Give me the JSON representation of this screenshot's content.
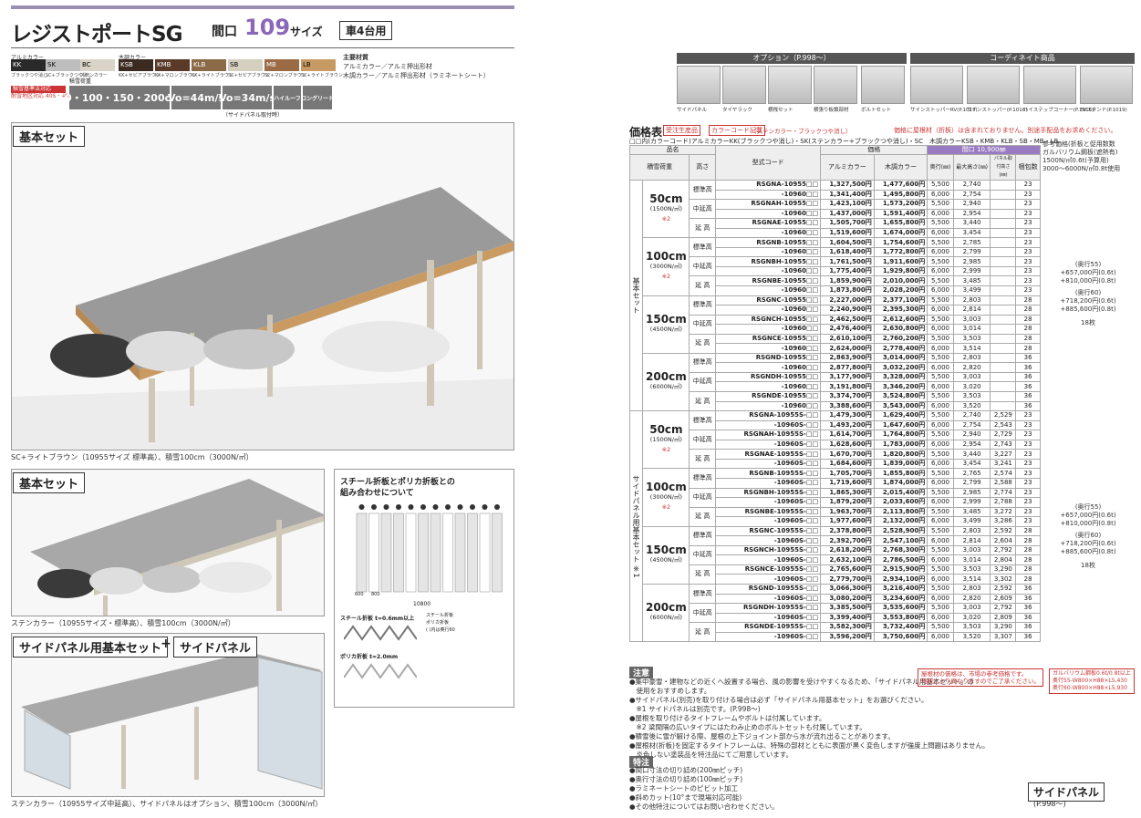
{
  "header": {
    "title": "レジストポートSG",
    "maguchi": "間口",
    "size": "109",
    "size_label": "サイズ",
    "cars": "車4台用"
  },
  "colors": {
    "alumi_label": "アルミカラー",
    "mokume_label": "木調カラー",
    "alumi": [
      {
        "code": "KK",
        "name": "ブラックつや消し",
        "hex": "#2a2a2a",
        "fg": "#fff"
      },
      {
        "code": "SK",
        "name": "SC+ブラックつや消し",
        "hex": "#bdbdbd",
        "fg": "#000"
      },
      {
        "code": "BC",
        "name": "ステンカラー",
        "hex": "#d9d4c7",
        "fg": "#000"
      }
    ],
    "mokume": [
      {
        "code": "KSB",
        "name": "KK+セピアブラウン",
        "hex": "#3b2a1f",
        "fg": "#fff"
      },
      {
        "code": "KMB",
        "name": "KK+マロンブラウン",
        "hex": "#5a3a28",
        "fg": "#fff"
      },
      {
        "code": "KLB",
        "name": "KK+ライトブラウン",
        "hex": "#8b6a47",
        "fg": "#fff"
      },
      {
        "code": "SB",
        "name": "SC+セピアブラウン",
        "hex": "#d5cfc0",
        "fg": "#000"
      },
      {
        "code": "MB",
        "name": "SC+マロンブラウン",
        "hex": "#9a6b45",
        "fg": "#fff"
      },
      {
        "code": "LB",
        "name": "SC+ライトブラウン",
        "hex": "#c79a63",
        "fg": "#000"
      }
    ]
  },
  "materials": [
    "主要材質",
    "アルミカラー／アルミ押出形材",
    "木調カラー／アルミ押出形材（ラミネートシート）"
  ],
  "specs": {
    "shintai": "積雪荷重",
    "snow": "50・100・150・200cm",
    "wind1": "Vo=44m/s",
    "wind2": "Vo=34m/s",
    "wind_note": "（サイドパネル取付時）",
    "extra": [
      "ハイルーフ",
      "ロングリード"
    ],
    "red_title": "積雪基準法対応",
    "red_sub": "耐雪地区対応 40S・40S・41X(750)"
  },
  "photos": [
    {
      "label": "基本セット",
      "caption": "SC+ライトブラウン（10955サイズ 標準高）、積雪100cm（3000N/㎡）"
    },
    {
      "label": "基本セット",
      "caption": "ステンカラー（10955サイズ・標準高）、積雪100cm（3000N/㎡）"
    },
    {
      "label": "サイドパネル用基本セット",
      "plus": "+",
      "label2": "サイドパネル",
      "caption": "ステンカラー（10955サイズ中延高）、サイドパネルはオプション、積雪100cm（3000N/㎡）"
    }
  ],
  "steel": {
    "title1": "スチール折板とポリカ折板との",
    "title2": "組み合わせについて",
    "dim1": "10800",
    "dim2": "600",
    "dim3": "800",
    "steel_label": "スチール折板 t=0.6mm以上",
    "poly_label": "ポリカ折板 t=2.0mm",
    "legend": [
      "スチール折板",
      "ポリカ折板",
      "( )内は奥行60"
    ]
  },
  "options": {
    "header": "オプション（P.998〜）",
    "coord": "コーディネイト商品",
    "items": [
      "サイドパネル",
      "タイヤラック",
      "横桟セット",
      "横張り板鎖部材",
      "ボルトセット",
      "サインストッパーRV(P.1017)",
      "サインストッパー(P.1016)",
      "ハイステップコーナー(P.1016)",
      "EVスタンド(P.1019)"
    ]
  },
  "price": {
    "title": "価格表",
    "tag1": "受注生産品",
    "tag2": "カラーコード記載",
    "tag2_note": "（ステンカラー・ブラックつや消し）",
    "red_note": "価格に屋根材（折板）は含まれておりません。別途手配品をお求めください。",
    "note1": "□□内(カラーコード)アルミカラーKK(ブラックつや消し)・SK(ステンカラー+ブラックつや消し)・SC　木調カラーKSB・KMB・KLB・SB・MB・LB",
    "maguchi": "間口 10,900㎜",
    "headers": {
      "hinmei": "品名",
      "sekisetsu": "積雪荷重",
      "takasa": "高さ",
      "code": "型式コード",
      "price": "価格",
      "alumi": "アルミカラー",
      "mokume": "木調カラー",
      "okuyuki": "奥行(㎜)",
      "saidai": "最大高さ(㎜)",
      "panel": "パネル取付高さ(㎜)",
      "orita": "梱包数"
    },
    "groups": [
      "基本セット",
      "サイドパネル用基本セット ※1"
    ],
    "rows": [
      [
        "50cm",
        "(1500N/㎡)",
        "※2",
        "標準高",
        "RSGNA-10955□□",
        "1,327,500円",
        "1,477,600円",
        "5,500",
        "2,740",
        "",
        "23"
      ],
      [
        "",
        "",
        "",
        "",
        "-10960□□",
        "1,341,400円",
        "1,495,800円",
        "6,000",
        "2,754",
        "",
        "23"
      ],
      [
        "",
        "",
        "",
        "中延高",
        "RSGNAH-10955□□",
        "1,423,100円",
        "1,573,200円",
        "5,500",
        "2,940",
        "",
        "23"
      ],
      [
        "",
        "",
        "",
        "",
        "-10960□□",
        "1,437,000円",
        "1,591,400円",
        "6,000",
        "2,954",
        "",
        "23"
      ],
      [
        "",
        "",
        "",
        "延 高",
        "RSGNAE-10955□□",
        "1,505,700円",
        "1,655,800円",
        "5,500",
        "3,440",
        "",
        "23"
      ],
      [
        "",
        "",
        "",
        "",
        "-10960□□",
        "1,519,600円",
        "1,674,000円",
        "6,000",
        "3,454",
        "",
        "23"
      ],
      [
        "100cm",
        "(3000N/㎡)",
        "※2",
        "標準高",
        "RSGNB-10955□□",
        "1,604,500円",
        "1,754,600円",
        "5,500",
        "2,785",
        "",
        "23"
      ],
      [
        "",
        "",
        "",
        "",
        "-10960□□",
        "1,618,400円",
        "1,772,800円",
        "6,000",
        "2,799",
        "",
        "23"
      ],
      [
        "",
        "",
        "",
        "中延高",
        "RSGNBH-10955□□",
        "1,761,500円",
        "1,911,600円",
        "5,500",
        "2,985",
        "",
        "23"
      ],
      [
        "",
        "",
        "",
        "",
        "-10960□□",
        "1,775,400円",
        "1,929,800円",
        "6,000",
        "2,999",
        "",
        "23"
      ],
      [
        "",
        "",
        "",
        "延 高",
        "RSGNBE-10955□□",
        "1,859,900円",
        "2,010,000円",
        "5,500",
        "3,485",
        "",
        "23"
      ],
      [
        "",
        "",
        "",
        "",
        "-10960□□",
        "1,873,800円",
        "2,028,200円",
        "6,000",
        "3,499",
        "",
        "23"
      ],
      [
        "150cm",
        "(4500N/㎡)",
        "",
        "標準高",
        "RSGNC-10955□□",
        "2,227,000円",
        "2,377,100円",
        "5,500",
        "2,803",
        "",
        "28"
      ],
      [
        "",
        "",
        "",
        "",
        "-10960□□",
        "2,240,900円",
        "2,395,300円",
        "6,000",
        "2,814",
        "",
        "28"
      ],
      [
        "",
        "",
        "",
        "中延高",
        "RSGNCH-10955□□",
        "2,462,500円",
        "2,612,600円",
        "5,500",
        "3,003",
        "",
        "28"
      ],
      [
        "",
        "",
        "",
        "",
        "-10960□□",
        "2,476,400円",
        "2,630,800円",
        "6,000",
        "3,014",
        "",
        "28"
      ],
      [
        "",
        "",
        "",
        "延 高",
        "RSGNCE-10955□□",
        "2,610,100円",
        "2,760,200円",
        "5,500",
        "3,503",
        "",
        "28"
      ],
      [
        "",
        "",
        "",
        "",
        "-10960□□",
        "2,624,000円",
        "2,778,400円",
        "6,000",
        "3,514",
        "",
        "28"
      ],
      [
        "200cm",
        "(6000N/㎡)",
        "",
        "標準高",
        "RSGND-10955□□",
        "2,863,900円",
        "3,014,000円",
        "5,500",
        "2,803",
        "",
        "36"
      ],
      [
        "",
        "",
        "",
        "",
        "-10960□□",
        "2,877,800円",
        "3,032,200円",
        "6,000",
        "2,820",
        "",
        "36"
      ],
      [
        "",
        "",
        "",
        "中延高",
        "RSGNDH-10955□□",
        "3,177,900円",
        "3,328,000円",
        "5,500",
        "3,003",
        "",
        "36"
      ],
      [
        "",
        "",
        "",
        "",
        "-10960□□",
        "3,191,800円",
        "3,346,200円",
        "6,000",
        "3,020",
        "",
        "36"
      ],
      [
        "",
        "",
        "",
        "延 高",
        "RSGNDE-10955□□",
        "3,374,700円",
        "3,524,800円",
        "5,500",
        "3,503",
        "",
        "36"
      ],
      [
        "",
        "",
        "",
        "",
        "-10960□□",
        "3,388,600円",
        "3,543,000円",
        "6,000",
        "3,520",
        "",
        "36"
      ],
      [
        "50cm",
        "(1500N/㎡)",
        "※2",
        "標準高",
        "RSGNA-10955S-□□",
        "1,479,300円",
        "1,629,400円",
        "5,500",
        "2,740",
        "2,529",
        "23"
      ],
      [
        "",
        "",
        "",
        "",
        "-10960S-□□",
        "1,493,200円",
        "1,647,600円",
        "6,000",
        "2,754",
        "2,543",
        "23"
      ],
      [
        "",
        "",
        "",
        "中延高",
        "RSGNAH-10955S-□□",
        "1,614,700円",
        "1,764,800円",
        "5,500",
        "2,940",
        "2,729",
        "23"
      ],
      [
        "",
        "",
        "",
        "",
        "-10960S-□□",
        "1,628,600円",
        "1,783,000円",
        "6,000",
        "2,954",
        "2,743",
        "23"
      ],
      [
        "",
        "",
        "",
        "延 高",
        "RSGNAE-10955S-□□",
        "1,670,700円",
        "1,820,800円",
        "5,500",
        "3,440",
        "3,227",
        "23"
      ],
      [
        "",
        "",
        "",
        "",
        "-10960S-□□",
        "1,684,600円",
        "1,839,000円",
        "6,000",
        "3,454",
        "3,241",
        "23"
      ],
      [
        "100cm",
        "(3000N/㎡)",
        "※2",
        "標準高",
        "RSGNB-10955S-□□",
        "1,705,700円",
        "1,855,800円",
        "5,500",
        "2,765",
        "2,574",
        "23"
      ],
      [
        "",
        "",
        "",
        "",
        "-10960S-□□",
        "1,719,600円",
        "1,874,000円",
        "6,000",
        "2,799",
        "2,588",
        "23"
      ],
      [
        "",
        "",
        "",
        "中延高",
        "RSGNBH-10955S-□□",
        "1,865,300円",
        "2,015,400円",
        "5,500",
        "2,985",
        "2,774",
        "23"
      ],
      [
        "",
        "",
        "",
        "",
        "-10960S-□□",
        "1,879,200円",
        "2,033,600円",
        "6,000",
        "2,999",
        "2,788",
        "23"
      ],
      [
        "",
        "",
        "",
        "延 高",
        "RSGNBE-10955S-□□",
        "1,963,700円",
        "2,113,800円",
        "5,500",
        "3,485",
        "3,272",
        "23"
      ],
      [
        "",
        "",
        "",
        "",
        "-10960S-□□",
        "1,977,600円",
        "2,132,000円",
        "6,000",
        "3,499",
        "3,286",
        "23"
      ],
      [
        "150cm",
        "(4500N/㎡)",
        "",
        "標準高",
        "RSGNC-10955S-□□",
        "2,378,800円",
        "2,528,900円",
        "5,500",
        "2,803",
        "2,592",
        "28"
      ],
      [
        "",
        "",
        "",
        "",
        "-10960S-□□",
        "2,392,700円",
        "2,547,100円",
        "6,000",
        "2,814",
        "2,604",
        "28"
      ],
      [
        "",
        "",
        "",
        "中延高",
        "RSGNCH-10955S-□□",
        "2,618,200円",
        "2,768,300円",
        "5,500",
        "3,003",
        "2,792",
        "28"
      ],
      [
        "",
        "",
        "",
        "",
        "-10960S-□□",
        "2,632,100円",
        "2,786,500円",
        "6,000",
        "3,014",
        "2,804",
        "28"
      ],
      [
        "",
        "",
        "",
        "延 高",
        "RSGNCE-10955S-□□",
        "2,765,600円",
        "2,915,900円",
        "5,500",
        "3,503",
        "3,290",
        "28"
      ],
      [
        "",
        "",
        "",
        "",
        "-10960S-□□",
        "2,779,700円",
        "2,934,100円",
        "6,000",
        "3,514",
        "3,302",
        "28"
      ],
      [
        "200cm",
        "(6000N/㎡)",
        "",
        "標準高",
        "RSGND-10955S-□□",
        "3,066,300円",
        "3,216,400円",
        "5,500",
        "2,803",
        "2,592",
        "36"
      ],
      [
        "",
        "",
        "",
        "",
        "-10960S-□□",
        "3,080,200円",
        "3,234,600円",
        "6,000",
        "2,820",
        "2,609",
        "36"
      ],
      [
        "",
        "",
        "",
        "中延高",
        "RSGNDH-10955S-□□",
        "3,385,500円",
        "3,535,600円",
        "5,500",
        "3,003",
        "2,792",
        "36"
      ],
      [
        "",
        "",
        "",
        "",
        "-10960S-□□",
        "3,399,400円",
        "3,553,800円",
        "6,000",
        "3,020",
        "2,809",
        "36"
      ],
      [
        "",
        "",
        "",
        "延 高",
        "RSGNDE-10955S-□□",
        "3,582,300円",
        "3,732,400円",
        "5,500",
        "3,503",
        "3,290",
        "36"
      ],
      [
        "",
        "",
        "",
        "",
        "-10960S-□□",
        "3,596,200円",
        "3,750,600円",
        "6,000",
        "3,520",
        "3,307",
        "36"
      ]
    ]
  },
  "right_notes": {
    "top": [
      "参考価格(折板と促用数数",
      "ガルバリウム鋼板(遮熱有)",
      "1500N/㎡0.6t(予算用)",
      "3000〜6000N/㎡0.8t使用"
    ],
    "b1": [
      "(奥行55)",
      "+657,000円(0.6t)",
      "+810,000円(0.8t)",
      "(奥行60)",
      "+718,200円(0.6t)",
      "+885,600円(0.8t)",
      "18枚"
    ]
  },
  "notes": {
    "head": "注意",
    "lines": [
      "●集中豪雪・建物などの近くへ設置する場合、風の影響を受けやすくなるため、「サイドパネル用基本セット」の",
      "　使用をおすすめします。",
      "●サイドパネル(別売)を取り付ける場合は必ず「サイドパネル用基本セット」をお選びください。",
      "　※1 サイドパネルは別売です。(P.998〜)",
      "●屋根を取り付けるタイトフレームやボルトは付属しています。",
      "　※2 梁間隔の広いタイプにはたわみ止めのボルトセットも付属しています。",
      "●積雪後に雪が解ける際、屋根の上下ジョイント部から水が流れ出ることがあります。",
      "●屋根材(折板)を固定するタイトフレームは、特殊の部材とともに表面が黒く変色しますが強度上問題はありません。",
      "　炎色しない塗装品を特注品にてご用意しています。"
    ],
    "head2": "特注",
    "lines2": [
      "●間口寸法の切り詰め(200㎜ピッチ)",
      "●奥行寸法の切り詰め(100㎜ピッチ)",
      "●ラミネートシートのピビット加工",
      "●斜めカット(10°まで現場対応可能)",
      "●その他特注についてはお問い合わせください。"
    ],
    "red_mid": [
      "屋根材の価格は、市場の参考価格です。",
      "地域により異なりますのでご了承ください。"
    ],
    "red_right": [
      "ガルバリウム鋼板0.6t/0.8t以上",
      "奥行55-W800×H88×L5,430",
      "奥行60-W800×H88×L5,930"
    ]
  },
  "side_panel": {
    "label": "サイドパネル",
    "sub": "(P.998〜)"
  }
}
